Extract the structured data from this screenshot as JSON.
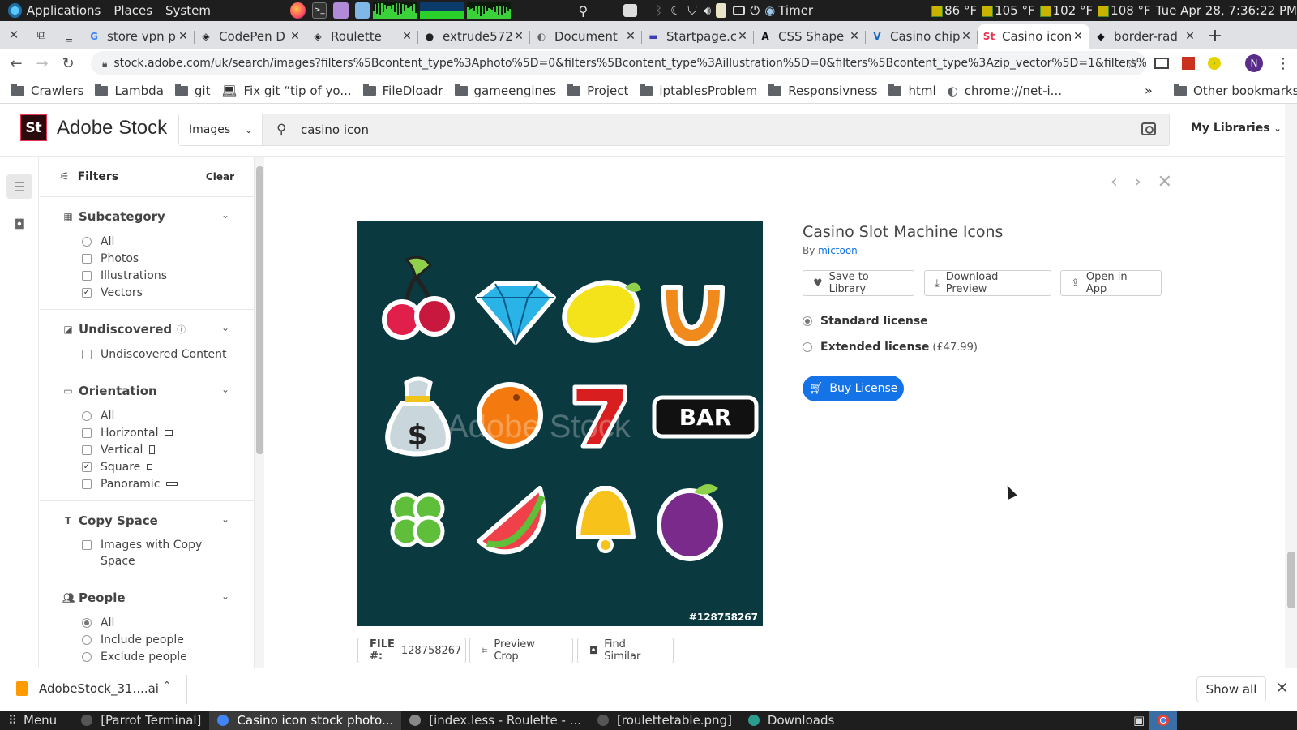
{
  "os_panel": {
    "menus": [
      "Applications",
      "Places",
      "System"
    ],
    "timer_label": "Timer",
    "temps": [
      "86 °F",
      "105 °F",
      "102 °F",
      "108 °F"
    ],
    "clock": "Tue Apr 28, 7:36:22 PM"
  },
  "tabs": [
    {
      "label": "store vpn p",
      "icon": "google-icon",
      "active": false
    },
    {
      "label": "CodePen D",
      "icon": "codepen-icon",
      "active": false
    },
    {
      "label": "Roulette",
      "icon": "codepen-icon",
      "active": false
    },
    {
      "label": "extrude572",
      "icon": "github-icon",
      "active": false
    },
    {
      "label": "Document",
      "icon": "globe-icon",
      "active": false
    },
    {
      "label": "Startpage.c",
      "icon": "startpage-icon",
      "active": false
    },
    {
      "label": "CSS Shape",
      "icon": "css-icon",
      "active": false
    },
    {
      "label": "Casino chip",
      "icon": "vuetify-icon",
      "active": false
    },
    {
      "label": "Casino icon",
      "icon": "adobe-stock-icon",
      "active": true
    },
    {
      "label": "border-rad",
      "icon": "mdn-icon",
      "active": false
    }
  ],
  "address": {
    "url": "stock.adobe.com/uk/search/images?filters%5Bcontent_type%3Aphoto%5D=0&filters%5Bcontent_type%3Aillustration%5D=0&filters%5Bcontent_type%3Azip_vector%5D=1&filters%5Bconte...",
    "profile_initial": "N"
  },
  "bookmarks": [
    {
      "label": "Crawlers",
      "icon": "folder-icon"
    },
    {
      "label": "Lambda",
      "icon": "folder-icon"
    },
    {
      "label": "git",
      "icon": "folder-icon"
    },
    {
      "label": "Fix git “tip of yo...",
      "icon": "laptop-icon"
    },
    {
      "label": "FileDloadr",
      "icon": "folder-icon"
    },
    {
      "label": "gameengines",
      "icon": "folder-icon"
    },
    {
      "label": "Project",
      "icon": "folder-icon"
    },
    {
      "label": "iptablesProblem",
      "icon": "folder-icon"
    },
    {
      "label": "Responsivness",
      "icon": "folder-icon"
    },
    {
      "label": "html",
      "icon": "folder-icon"
    },
    {
      "label": "chrome://net-i...",
      "icon": "globe-icon"
    }
  ],
  "bookmarks_overflow": "»",
  "other_bookmarks": "Other bookmarks",
  "adobe": {
    "logo": "St",
    "brand": "Adobe Stock",
    "search_type": "Images",
    "search_query": "casino icon",
    "my_libraries": "My Libraries"
  },
  "filters": {
    "title": "Filters",
    "clear": "Clear",
    "sections": [
      {
        "title": "Subcategory",
        "icon": "grid-icon",
        "options": [
          {
            "label": "All",
            "kind": "radio",
            "on": false
          },
          {
            "label": "Photos",
            "kind": "check",
            "on": false
          },
          {
            "label": "Illustrations",
            "kind": "check",
            "on": false
          },
          {
            "label": "Vectors",
            "kind": "check",
            "on": true
          }
        ]
      },
      {
        "title": "Undiscovered",
        "icon": "undiscovered-icon",
        "options": [
          {
            "label": "Undiscovered Content",
            "kind": "check",
            "on": false
          }
        ]
      },
      {
        "title": "Orientation",
        "icon": "orientation-icon",
        "options": [
          {
            "label": "All",
            "kind": "radio",
            "on": false
          },
          {
            "label": "Horizontal",
            "kind": "check",
            "on": false,
            "shape": "horizontal"
          },
          {
            "label": "Vertical",
            "kind": "check",
            "on": false,
            "shape": "vertical"
          },
          {
            "label": "Square",
            "kind": "check",
            "on": true,
            "shape": "square"
          },
          {
            "label": "Panoramic",
            "kind": "check",
            "on": false,
            "shape": "panoramic"
          }
        ]
      },
      {
        "title": "Copy Space",
        "icon": "copy-space-icon",
        "options": [
          {
            "label": "Images with Copy Space",
            "kind": "check",
            "on": false
          }
        ]
      },
      {
        "title": "People",
        "icon": "people-icon",
        "options": [
          {
            "label": "All",
            "kind": "radio",
            "on": true
          },
          {
            "label": "Include people",
            "kind": "radio",
            "on": false
          },
          {
            "label": "Exclude people",
            "kind": "radio",
            "on": false
          }
        ]
      }
    ]
  },
  "asset": {
    "title": "Casino Slot Machine Icons",
    "by": "By",
    "author": "mictoon",
    "image_id": "#128758267",
    "watermark": "Adobe Stock",
    "bar_text": "BAR",
    "actions": {
      "save": "Save to Library",
      "download": "Download Preview",
      "open": "Open in App"
    },
    "licenses": [
      {
        "label": "Standard license",
        "price": "",
        "selected": true
      },
      {
        "label": "Extended license",
        "price": "(£47.99)",
        "selected": false
      }
    ],
    "buy": "Buy License",
    "file_label": "FILE #:",
    "file_number": "128758267",
    "preview_crop": "Preview Crop",
    "find_similar": "Find Similar"
  },
  "download_shelf": {
    "file": "AdobeStock_31....ai",
    "show_all": "Show all"
  },
  "taskbar": {
    "menu": "Menu",
    "items": [
      {
        "label": "[Parrot Terminal]",
        "active": false
      },
      {
        "label": "Casino icon stock photo...",
        "active": true
      },
      {
        "label": "[index.less - Roulette - ...",
        "active": false
      },
      {
        "label": "[roulettetable.png]",
        "active": false
      },
      {
        "label": "Downloads",
        "active": false
      }
    ]
  },
  "colors": {
    "adobe_red": "#ea3654",
    "accent_blue": "#1473e6",
    "preview_bg": "#0a3a40"
  }
}
